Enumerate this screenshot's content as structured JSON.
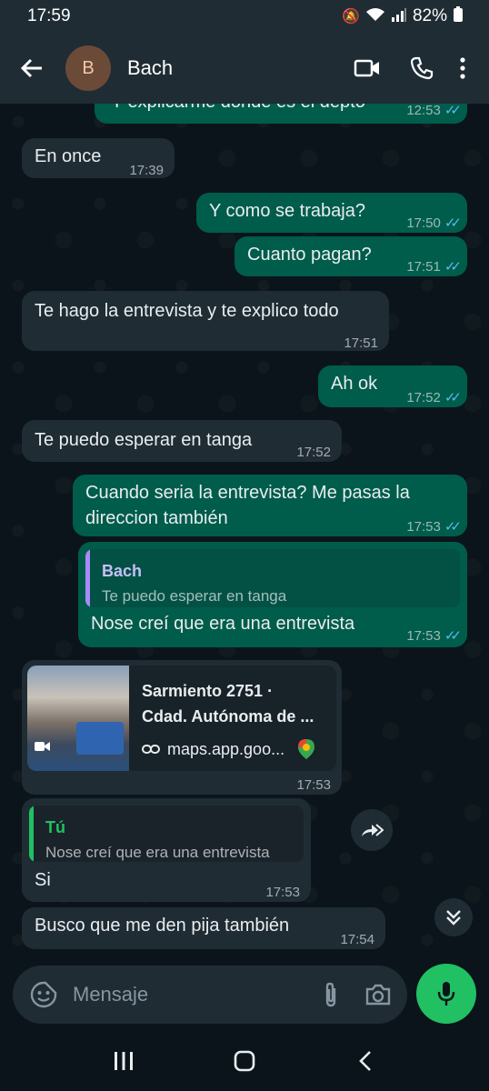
{
  "status": {
    "time": "17:59",
    "battery": "82%"
  },
  "header": {
    "avatar_letter": "B",
    "contact": "Bach"
  },
  "messages": [
    {
      "text": "Y explicarme donde es el depto",
      "time": "12:53"
    },
    {
      "text": "En once",
      "time": "17:39"
    },
    {
      "text": "Y como se trabaja?",
      "time": "17:50"
    },
    {
      "text": "Cuanto pagan?",
      "time": "17:51"
    },
    {
      "text": "Te hago la entrevista y te explico todo",
      "time": "17:51"
    },
    {
      "text": "Ah ok",
      "time": "17:52"
    },
    {
      "text": "Te puedo esperar en tanga",
      "time": "17:52"
    },
    {
      "text_line1": "Cuando seria la entrevista? Me pasas la",
      "text_line2": "direccion también",
      "time": "17:53"
    },
    {
      "quote_name": "Bach",
      "quote_text": "Te puedo esperar en tanga",
      "text": "Nose creí que era una entrevista",
      "time": "17:53"
    },
    {
      "map_title1": "Sarmiento 2751 ·",
      "map_title2": "Cdad. Autónoma de ...",
      "map_link": "maps.app.goo...",
      "time": "17:53"
    },
    {
      "quote_name": "Tú",
      "quote_text": "Nose creí que era una entrevista",
      "text": "Si",
      "time": "17:53"
    },
    {
      "text": "Busco que me den pija también",
      "time": "17:54"
    }
  ],
  "input": {
    "placeholder": "Mensaje"
  },
  "colors": {
    "outgoing": "#005c4b",
    "incoming": "#1f2c34",
    "accent": "#21c063",
    "ticks": "#53bdeb"
  }
}
